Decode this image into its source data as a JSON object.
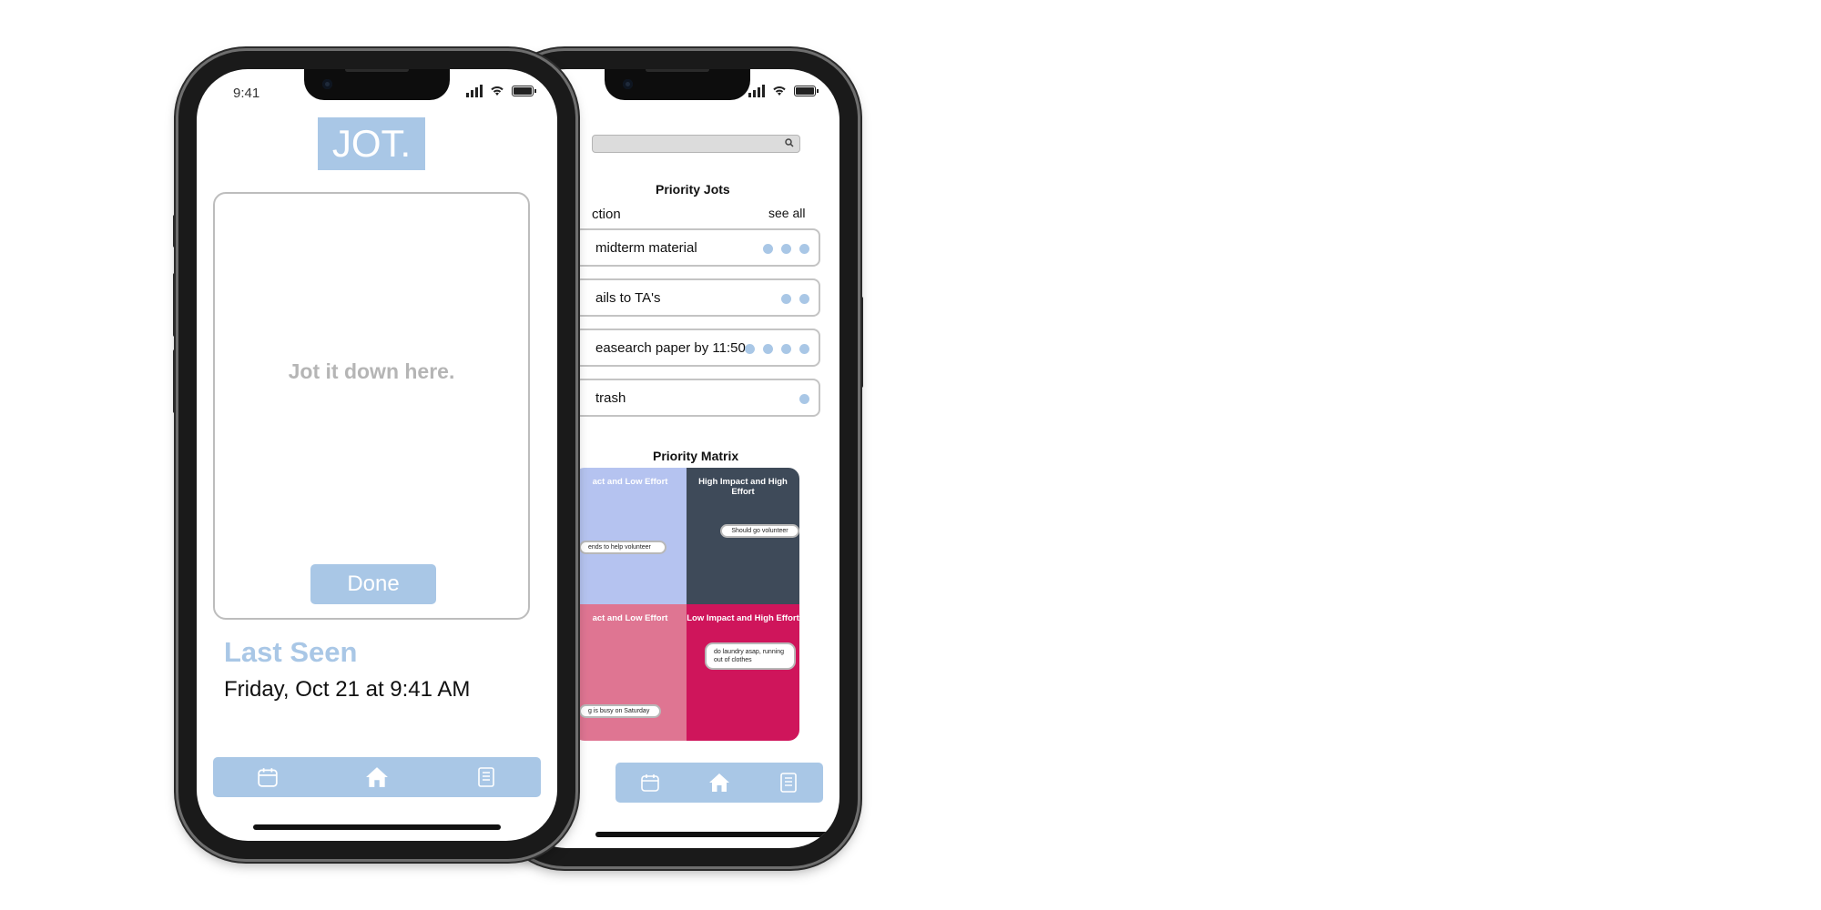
{
  "back_phone": {
    "status": {
      "time": ""
    },
    "search": {
      "placeholder": ""
    },
    "priority_jots": {
      "title": "Priority Jots",
      "section_label": "ction",
      "see_all": "see all",
      "rows": [
        {
          "text": "midterm material",
          "dots": 3
        },
        {
          "text": "ails to TA's",
          "dots": 2
        },
        {
          "text": "easearch paper by 11:50",
          "dots": 4
        },
        {
          "text": "trash",
          "dots": 1
        }
      ]
    },
    "priority_matrix": {
      "title": "Priority Matrix",
      "quadrants": [
        {
          "title": "act and Low Effort",
          "color": "#b5c3f0",
          "item": "ends to help volunteer"
        },
        {
          "title": "High Impact and High Effort",
          "color": "#3e4a59",
          "item": "Should go volunteer"
        },
        {
          "title": "act and Low Effort",
          "color": "#df7592",
          "item": "g is busy on Saturday"
        },
        {
          "title": "Low Impact and High Effort",
          "color": "#cf155b",
          "item": "do laundry asap, running out of clothes"
        }
      ]
    },
    "tabs": [
      "calendar",
      "home",
      "notes"
    ]
  },
  "front_phone": {
    "status": {
      "time": "9:41"
    },
    "logo": "JOT.",
    "jot_input": {
      "placeholder": "Jot it down here."
    },
    "done_button": "Done",
    "last_seen": {
      "label": "Last Seen",
      "date": "Friday, Oct 21 at 9:41 AM"
    },
    "tabs": [
      "calendar",
      "home",
      "notes"
    ]
  },
  "colors": {
    "accent": "#a9c7e6",
    "frame": "#1a1a1a",
    "placeholder_gray": "#b5b5b5"
  }
}
